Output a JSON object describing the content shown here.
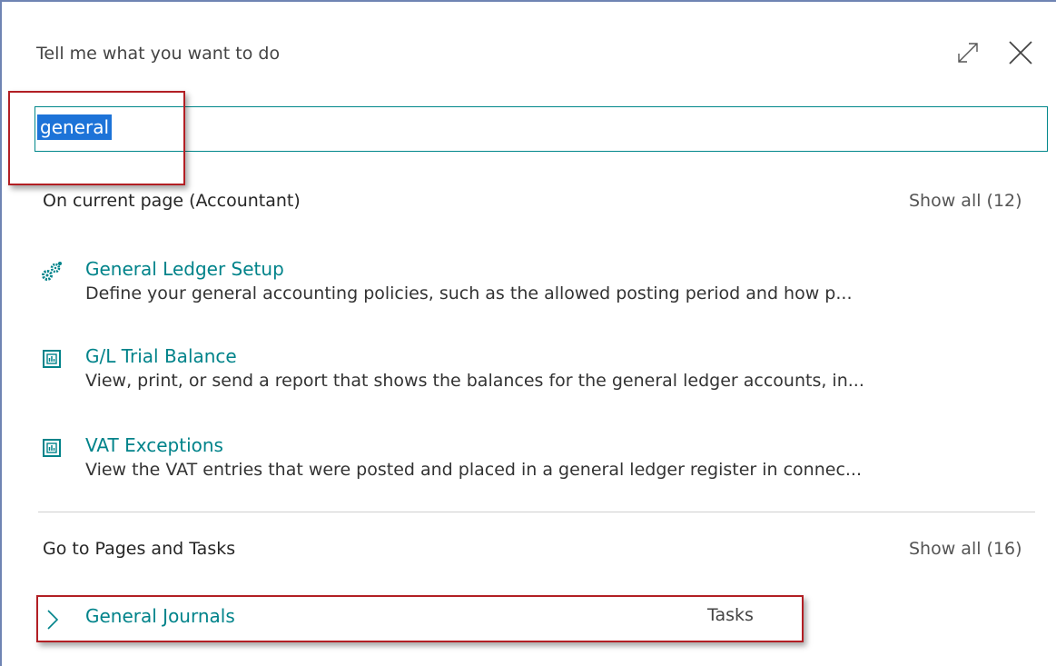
{
  "header": {
    "title": "Tell me what you want to do",
    "expand_icon": "expand-icon",
    "close_icon": "close-icon"
  },
  "search": {
    "value": "general"
  },
  "current_page": {
    "heading": "On current page (Accountant)",
    "show_all": "Show all (12)",
    "results": [
      {
        "icon": "gear-cluster-icon",
        "title": "General Ledger Setup",
        "description": "Define your general accounting policies, such as the allowed posting period and how p..."
      },
      {
        "icon": "report-icon",
        "title": "G/L Trial Balance",
        "description": "View, print, or send a report that shows the balances for the general ledger accounts, in..."
      },
      {
        "icon": "report-icon",
        "title": "VAT Exceptions",
        "description": "View the VAT entries that were posted and placed in a general ledger register in connec..."
      }
    ]
  },
  "pages_tasks": {
    "heading": "Go to Pages and Tasks",
    "show_all": "Show all (16)",
    "items": [
      {
        "icon": "chevron-right-icon",
        "title": "General Journals",
        "category": "Tasks"
      }
    ]
  },
  "colors": {
    "accent": "#00838a",
    "selection": "#1d73d8",
    "highlight_box": "#b21f24"
  }
}
